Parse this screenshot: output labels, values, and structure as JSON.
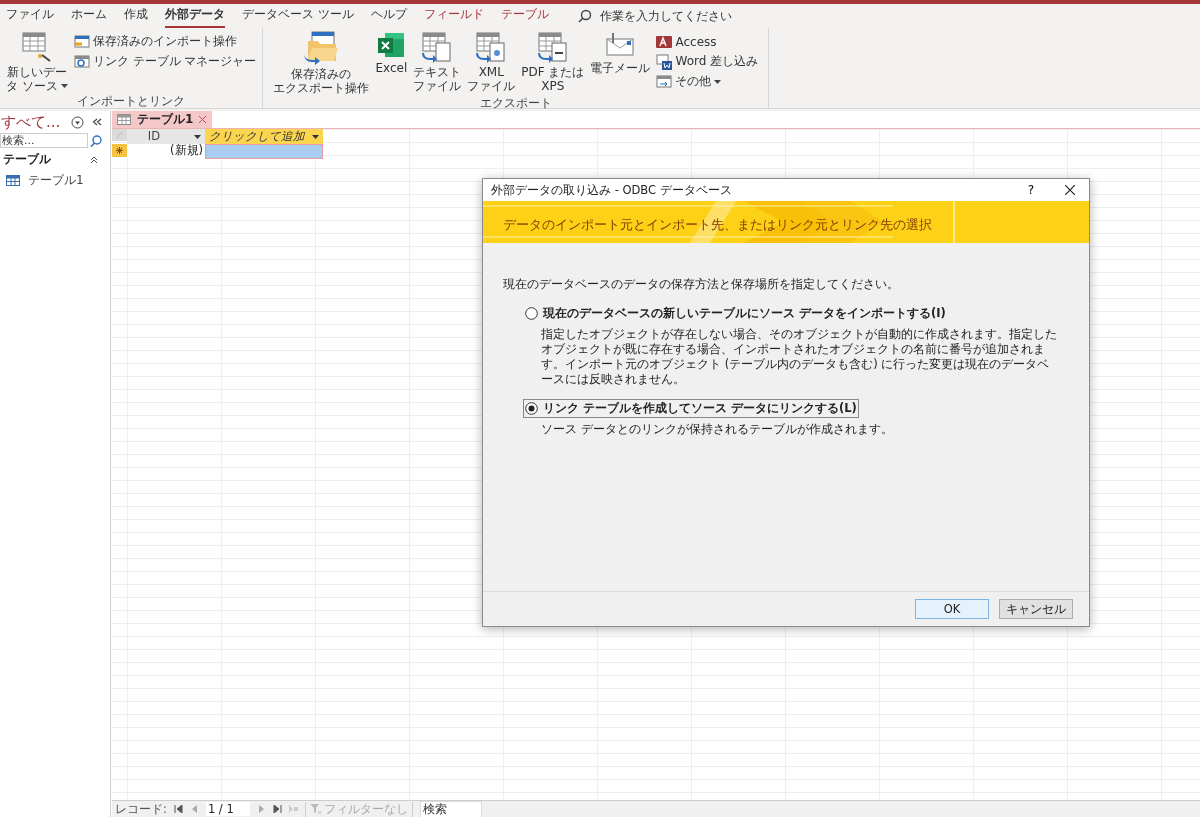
{
  "ribbon_tabs": [
    {
      "label": "ファイル",
      "kind": "normal",
      "selected": false
    },
    {
      "label": "ホーム",
      "kind": "normal",
      "selected": false
    },
    {
      "label": "作成",
      "kind": "normal",
      "selected": false
    },
    {
      "label": "外部データ",
      "kind": "normal",
      "selected": true
    },
    {
      "label": "データベース ツール",
      "kind": "normal",
      "selected": false
    },
    {
      "label": "ヘルプ",
      "kind": "normal",
      "selected": false
    },
    {
      "label": "フィールド",
      "kind": "context",
      "selected": false
    },
    {
      "label": "テーブル",
      "kind": "context",
      "selected": false
    }
  ],
  "tell_me": {
    "placeholder": "作業を入力してください"
  },
  "ribbon_groups": [
    {
      "label": "インポートとリンク",
      "items": [
        {
          "kind": "large",
          "lines": [
            "新しいデー",
            "タ ソース"
          ],
          "dropdown": true
        },
        {
          "kind": "stack",
          "items": [
            {
              "label": "保存済みのインポート操作",
              "dropdown": false
            },
            {
              "label": "リンク テーブル マネージャー",
              "dropdown": false
            }
          ]
        }
      ]
    },
    {
      "label": "エクスポート",
      "items": [
        {
          "kind": "large",
          "lines": [
            "保存済みの",
            "エクスポート操作"
          ],
          "dropdown": false
        },
        {
          "kind": "large",
          "lines": [
            "Excel"
          ],
          "dropdown": false
        },
        {
          "kind": "large",
          "lines": [
            "テキスト",
            "ファイル"
          ],
          "dropdown": false
        },
        {
          "kind": "large",
          "lines": [
            "XML",
            "ファイル"
          ],
          "dropdown": false
        },
        {
          "kind": "large",
          "lines": [
            "PDF または",
            "XPS"
          ],
          "dropdown": false
        },
        {
          "kind": "large",
          "lines": [
            "電子メール"
          ],
          "dropdown": false
        },
        {
          "kind": "stack",
          "items": [
            {
              "label": "Access",
              "dropdown": false
            },
            {
              "label": "Word 差し込み",
              "dropdown": false
            },
            {
              "label": "その他",
              "dropdown": true
            }
          ]
        }
      ]
    }
  ],
  "nav_pane": {
    "title": "すべて...",
    "search": {
      "placeholder": "検索..."
    },
    "groups": [
      {
        "label": "テーブル",
        "expanded": true,
        "items": [
          {
            "label": "テーブル1"
          }
        ]
      }
    ]
  },
  "document_tab": {
    "label": "テーブル1",
    "selected": true
  },
  "datasheet": {
    "columns": [
      {
        "label": "ID",
        "kind": "field"
      },
      {
        "label": "クリックして追加",
        "kind": "add"
      }
    ],
    "new_row": {
      "cells": [
        "(新規)",
        ""
      ]
    }
  },
  "status_bar": {
    "label": "レコード:",
    "position": "1 / 1",
    "filter": {
      "label": "フィルターなし",
      "disabled": true
    },
    "search": {
      "placeholder": "検索"
    }
  },
  "dialog": {
    "title": "外部データの取り込み - ODBC データベース",
    "help": "?",
    "banner": "データのインポート元とインポート先、またはリンク元とリンク先の選択",
    "instruction": "現在のデータベースのデータの保存方法と保存場所を指定してください。",
    "options": [
      {
        "label": "現在のデータベースの新しいテーブルにソース データをインポートする(I)",
        "description": "指定したオブジェクトが存在しない場合、そのオブジェクトが自動的に作成されます。指定したオブジェクトが既に存在する場合、インポートされたオブジェクトの名前に番号が追加されます。インポート元のオブジェクト (テーブル内のデータも含む) に行った変更は現在のデータベースには反映されません。",
        "selected": false
      },
      {
        "label": "リンク テーブルを作成してソース データにリンクする(L)",
        "description": "ソース データとのリンクが保持されるテーブルが作成されます。",
        "selected": true
      }
    ],
    "buttons": [
      {
        "label": "OK",
        "kind": "default"
      },
      {
        "label": "キャンセル",
        "kind": "normal"
      }
    ]
  }
}
